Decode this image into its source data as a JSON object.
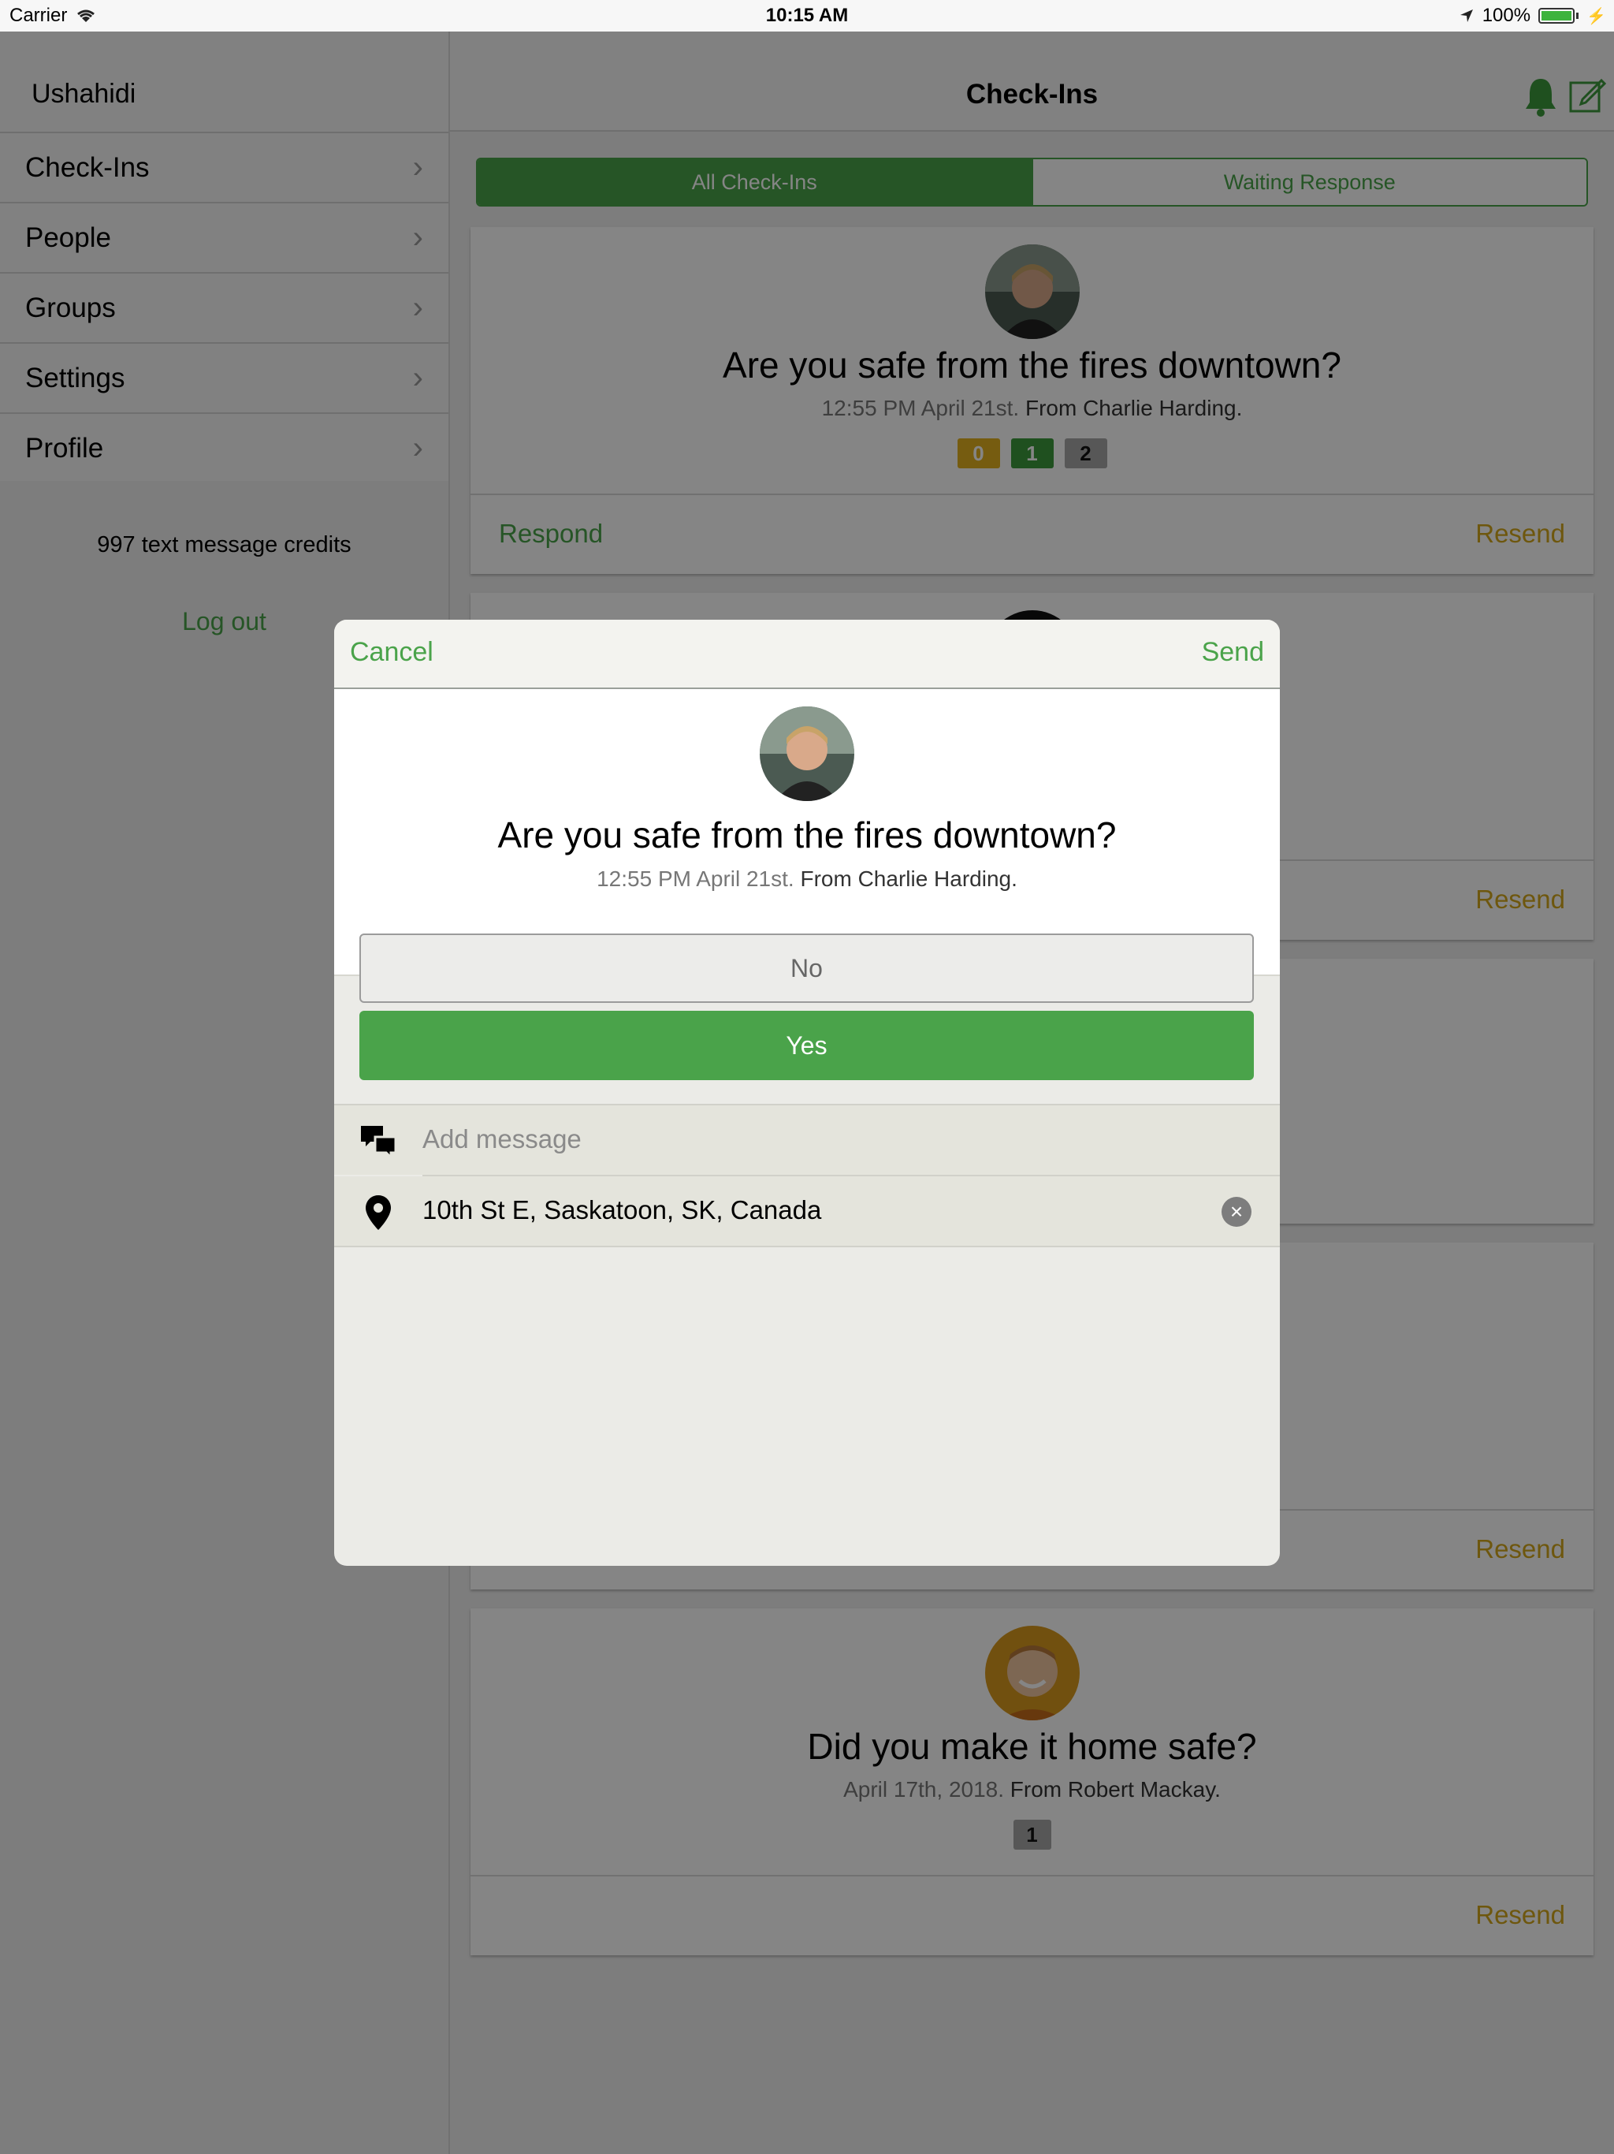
{
  "status_bar": {
    "carrier": "Carrier",
    "time": "10:15 AM",
    "battery": "100%"
  },
  "sidebar": {
    "title": "Ushahidi",
    "items": [
      {
        "label": "Check-Ins"
      },
      {
        "label": "People"
      },
      {
        "label": "Groups"
      },
      {
        "label": "Settings"
      },
      {
        "label": "Profile"
      }
    ],
    "credits": "997 text message credits",
    "logout": "Log out"
  },
  "header": {
    "title": "Check-Ins",
    "icons": [
      "bell-icon",
      "compose-icon"
    ]
  },
  "tabs": [
    {
      "label": "All Check-Ins",
      "active": true
    },
    {
      "label": "Waiting Response",
      "active": false
    }
  ],
  "cards": [
    {
      "question": "Are you safe from the fires downtown?",
      "time": "12:55 PM April 21st.",
      "from": "From Charlie Harding.",
      "badges": [
        "0",
        "1",
        "2"
      ],
      "respond": "Respond",
      "resend": "Resend"
    },
    {
      "resend": "Resend"
    },
    {
      "resend": "Resend"
    },
    {
      "question": "Did you make it home safe?",
      "time": "April 17th, 2018.",
      "from": "From Robert Mackay.",
      "badges": [
        "1"
      ],
      "resend": "Resend"
    }
  ],
  "modal": {
    "cancel": "Cancel",
    "send": "Send",
    "question": "Are you safe from the fires downtown?",
    "time": "12:55 PM April 21st.",
    "from": "From Charlie Harding.",
    "options": [
      {
        "label": "No",
        "selected": false
      },
      {
        "label": "Yes",
        "selected": true
      }
    ],
    "message_placeholder": "Add message",
    "location": "10th St E, Saskatoon, SK, Canada"
  },
  "colors": {
    "accent_green": "#4aa34a",
    "resend_yellow": "#d4a71c",
    "badge_yellow": "#e3b11f",
    "badge_green": "#3d9a3d",
    "badge_gray": "#a8a8a8"
  }
}
